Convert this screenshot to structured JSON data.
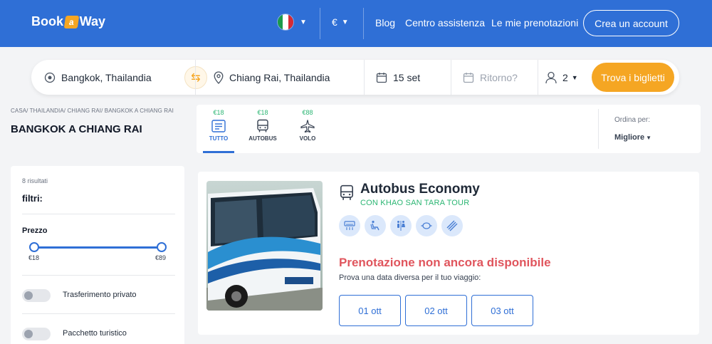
{
  "header": {
    "logo_left": "Book",
    "logo_badge": "a",
    "logo_right": "Way",
    "language_flag": "italy-flag",
    "currency": "€",
    "nav": [
      "Blog",
      "Centro assistenza",
      "Le mie prenotazioni"
    ],
    "signup_label": "Crea un account"
  },
  "search": {
    "from": "Bangkok, Thailandia",
    "to": "Chiang Rai, Thailandia",
    "date": "15 set",
    "return_placeholder": "Ritorno?",
    "passengers": "2",
    "submit_label": "Trova i biglietti"
  },
  "breadcrumb": "CASA/ THAILANDIA/ CHIANG RAI/ BANGKOK A CHIANG RAI",
  "page_title": "BANGKOK A CHIANG RAI",
  "tabs": [
    {
      "price": "€18",
      "label": "TUTTO",
      "icon": "list-icon",
      "active": true
    },
    {
      "price": "€18",
      "label": "AUTOBUS",
      "icon": "bus-icon",
      "active": false
    },
    {
      "price": "€88",
      "label": "VOLO",
      "icon": "plane-icon",
      "active": false
    }
  ],
  "sort": {
    "label": "Ordina per:",
    "value": "Migliore"
  },
  "filters": {
    "results_count": "8 risultati",
    "title": "filtri:",
    "price_label": "Prezzo",
    "price_min": "€18",
    "price_max": "€89",
    "options": [
      "Trasferimento privato",
      "Pacchetto turistico"
    ]
  },
  "result": {
    "title": "Autobus Economy",
    "operator": "CON KHAO SAN TARA TOUR",
    "amenities": [
      "ac-icon",
      "reclining-seat-icon",
      "toilet-icon",
      "snack-icon",
      "wifi-icon"
    ],
    "status": "Prenotazione non ancora disponibile",
    "hint": "Prova una data diversa per il tuo viaggio:",
    "dates": [
      "01 ott",
      "02 ott",
      "03 ott"
    ]
  },
  "colors": {
    "brand_blue": "#2f6fd6",
    "accent_orange": "#f5a623",
    "price_green": "#2bb673",
    "error_red": "#e0555d"
  }
}
